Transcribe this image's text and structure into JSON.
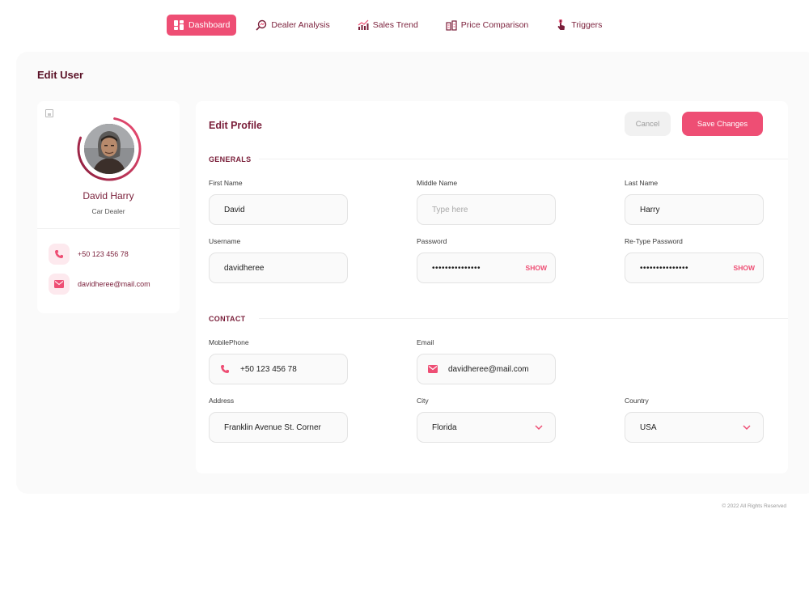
{
  "nav": {
    "items": [
      {
        "label": "Dashboard",
        "active": true
      },
      {
        "label": "Dealer Analysis",
        "active": false
      },
      {
        "label": "Sales Trend",
        "active": false
      },
      {
        "label": "Price Comparison",
        "active": false
      },
      {
        "label": "Triggers",
        "active": false
      }
    ]
  },
  "page": {
    "title": "Edit User"
  },
  "profile": {
    "name": "David Harry",
    "role": "Car Dealer",
    "phone": "+50 123 456 78",
    "email": "davidheree@mail.com",
    "progress_ring": 0.78
  },
  "form": {
    "title": "Edit Profile",
    "cancel_label": "Cancel",
    "save_label": "Save Changes",
    "generals_heading": "GENERALS",
    "contact_heading": "CONTACT",
    "first_name": {
      "label": "First Name",
      "value": "David"
    },
    "middle_name": {
      "label": "Middle Name",
      "placeholder": "Type here"
    },
    "last_name": {
      "label": "Last Name",
      "value": "Harry"
    },
    "username": {
      "label": "Username",
      "value": "davidheree"
    },
    "password": {
      "label": "Password",
      "value": "•••••••••••••••",
      "toggle": "SHOW"
    },
    "retype_password": {
      "label": "Re-Type Password",
      "value": "•••••••••••••••",
      "toggle": "SHOW"
    },
    "mobile_phone": {
      "label": "MobilePhone",
      "value": "+50 123 456 78"
    },
    "email": {
      "label": "Email",
      "value": "davidheree@mail.com"
    },
    "address": {
      "label": "Address",
      "value": "Franklin Avenue St. Corner"
    },
    "city": {
      "label": "City",
      "value": "Florida"
    },
    "country": {
      "label": "Country",
      "value": "USA"
    }
  },
  "footer": {
    "copyright": "© 2022 All Rights Reserved"
  },
  "colors": {
    "accent": "#ee4e74",
    "brand_text": "#7a1f3a",
    "background": "#fafafa"
  }
}
